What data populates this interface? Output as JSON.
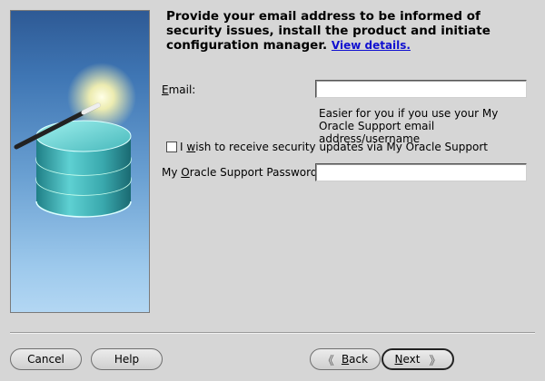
{
  "header": {
    "instruction": "Provide your email address to be informed of security issues, install the product and initiate configuration manager.",
    "view_details_link": "View details."
  },
  "form": {
    "email": {
      "label_prefix": "",
      "label_mnemonic": "E",
      "label_rest": "mail:",
      "value": "",
      "hint": "Easier for you if you use your My Oracle Support email address/username"
    },
    "security_updates": {
      "label_prefix": "I ",
      "label_mnemonic": "w",
      "label_rest": "ish to receive security updates via My Oracle Support",
      "checked": false
    },
    "password": {
      "label_prefix": "My ",
      "label_mnemonic": "O",
      "label_rest": "racle Support Password:",
      "value": ""
    }
  },
  "buttons": {
    "cancel": "Cancel",
    "help": "Help",
    "back_mnemonic": "B",
    "back_rest": "ack",
    "next_mnemonic": "N",
    "next_rest": "ext",
    "back_chevron": "《",
    "next_chevron": "》"
  },
  "icons": {
    "side_graphic": "database-wand-icon"
  },
  "colors": {
    "background": "#d6d6d6",
    "link": "#1010d0",
    "panel_top": "#2e5a95",
    "panel_bottom": "#b3d7f3",
    "cylinder": "#3aa9ae"
  }
}
